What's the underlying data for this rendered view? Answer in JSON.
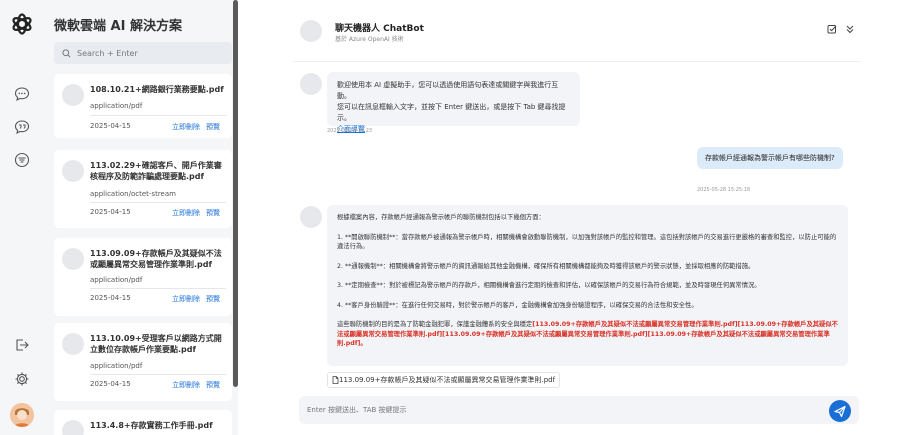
{
  "app": {
    "title": "微軟雲端 AI 解決方案"
  },
  "search": {
    "placeholder": "Search + Enter"
  },
  "documents": [
    {
      "name": "108.10.21+網路銀行業務要點.pdf",
      "type": "application/pdf",
      "date": "2025-04-15",
      "delete_label": "立即刪除",
      "preview_label": "預覽"
    },
    {
      "name": "113.02.29+確認客戶、開戶作業審核程序及防範詐騙處理要點.pdf",
      "type": "application/octet-stream",
      "date": "2025-04-15",
      "delete_label": "立即刪除",
      "preview_label": "預覽"
    },
    {
      "name": "113.09.09+存款帳戶及其疑似不法或顯屬異常交易管理作業準則.pdf",
      "type": "application/pdf",
      "date": "2025-04-15",
      "delete_label": "立即刪除",
      "preview_label": "預覽"
    },
    {
      "name": "113.10.09+受理客戶以網路方式開立數位存款帳戶作業要點.pdf",
      "type": "application/pdf",
      "date": "2025-04-15",
      "delete_label": "立即刪除",
      "preview_label": "預覽"
    },
    {
      "name": "113.4.8+存款實務工作手冊.pdf",
      "type": "",
      "date": "",
      "delete_label": "",
      "preview_label": ""
    }
  ],
  "chat": {
    "title": "聊天機器人 ChatBot",
    "subtitle": "基於 Azure OpenAI 技術",
    "welcome": {
      "line1": "歡迎使用本 AI 虛擬助手，您可以透過使用語句表達或關鍵字與我進行互動。",
      "line2": "您可以在訊息框輸入文字，並按下 Enter 鍵送出，或是按下 Tab 鍵尋找提示。",
      "guide_link": "介面導覽",
      "timestamp": "2025-05-28 15:23"
    },
    "user_message": {
      "text": "存款帳戶經通報為警示帳戶有哪些防機制?",
      "timestamp": "2025-05-28 15:25:18"
    },
    "answer": {
      "intro": "根據檔案內容，存款帳戶經通報為警示帳戶的聯防機制包括以下幾個方面：",
      "p1": "1. **開啟聯防機制**：當存款帳戶被通報為警示帳戶時，相關機構會啟動聯防機制，以加強對該帳戶的監控和管理。這包括對該帳戶的交易進行更嚴格的審查和監控，以防止可能的違法行為。",
      "p2": "2. **通報機制**：相關機構會將警示帳戶的資訊通報給其他金融機構，確保所有相關機構都能夠及時獲得該帳戶的警示狀態，並採取相應的防範措施。",
      "p3": "3. **定期檢查**：對於被標記為警示帳戶的存款戶，相關機構會進行定期的檢查和評估，以確保該帳戶的交易行為符合規範，並及時發現任何異常情況。",
      "p4": "4. **客戶身份驗證**：在進行任何交易時，對於警示帳戶的客戶，金融機構會加強身份驗證程序，以確保交易的合法性和安全性。",
      "closing": "這些聯防機制的目的是為了防範金融犯罪，保護金融體系的安全與穩定",
      "citation": "[113.09.09+存款帳戶及其疑似不法或顯屬異常交易管理作業準則.pdf][113.09.09+存款帳戶及其疑似不法或顯屬異常交易管理作業準則.pdf][113.09.09+存款帳戶及其疑似不法或顯屬異常交易管理作業準則.pdf][113.09.09+存款帳戶及其疑似不法或顯屬異常交易管理作業準則.pdf]。"
    },
    "attachment": "113.09.09+存款帳戶及其疑似不法或顯屬異常交易管理作業準則.pdf",
    "composer_placeholder": "Enter 按鍵送出、TAB 按鍵提示"
  },
  "colors": {
    "accent": "#1a6fd6",
    "citation": "#d93025",
    "user_bubble": "#dcebf9",
    "panel_bg": "#f4f6f8"
  }
}
